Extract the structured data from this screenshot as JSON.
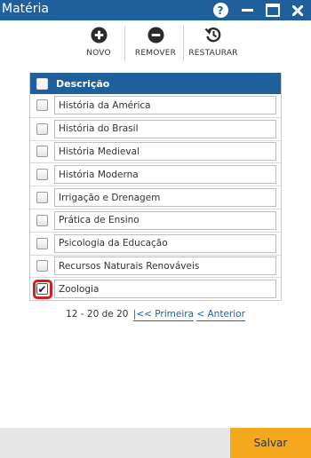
{
  "window": {
    "title": "Matéria",
    "title_bar_color": "#1f5f9c"
  },
  "title_buttons": {
    "help_label": "?",
    "help_icon": "help-icon",
    "minimize_icon": "minimize-icon",
    "maximize_icon": "maximize-icon",
    "close_icon": "close-icon"
  },
  "toolbar": {
    "novo_label": "NOVO",
    "remover_label": "REMOVER",
    "restaurar_label": "RESTAURAR",
    "novo_icon": "plus-circle-icon",
    "remover_icon": "minus-circle-icon",
    "restaurar_icon": "restore-icon"
  },
  "grid": {
    "header": "Descrição",
    "header_color": "#1f5f9c",
    "rows": [
      {
        "label": "História da América",
        "checked": false
      },
      {
        "label": "História do Brasil",
        "checked": false
      },
      {
        "label": "História Medieval",
        "checked": false
      },
      {
        "label": "História Moderna",
        "checked": false
      },
      {
        "label": "Irrigação e Drenagem",
        "checked": false
      },
      {
        "label": "Prática de Ensino",
        "checked": false
      },
      {
        "label": "Psicologia da Educação",
        "checked": false
      },
      {
        "label": "Recursos Naturais Renováveis",
        "checked": false
      },
      {
        "label": "Zoologia",
        "checked": true
      }
    ]
  },
  "pager": {
    "range": "12 - 20 de 20",
    "first_label": "|<< Primeira",
    "prev_label": "< Anterior"
  },
  "footer": {
    "save_label": "Salvar",
    "save_color": "#f5a81d"
  }
}
